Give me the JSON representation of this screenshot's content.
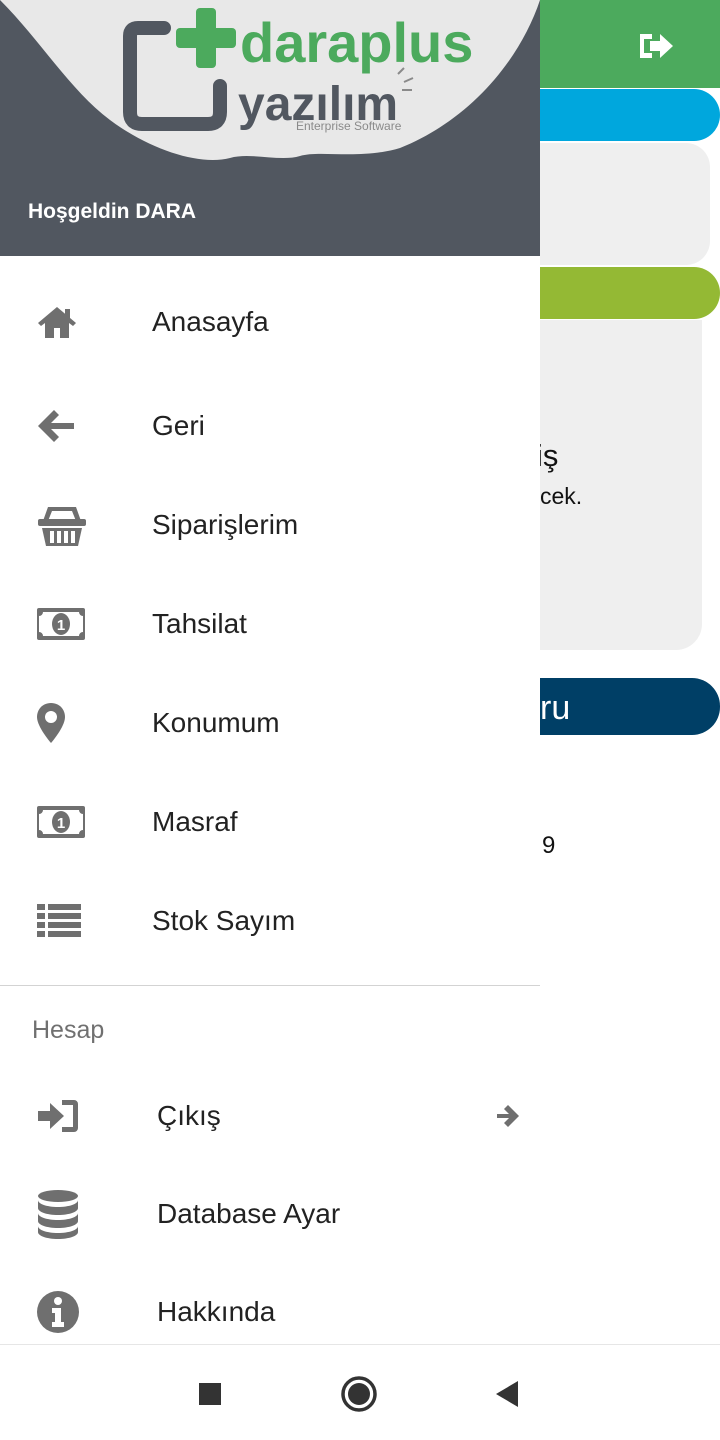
{
  "background": {
    "partial_text_1": "iş",
    "partial_text_2": "cek.",
    "partial_button_label": "ru",
    "partial_text_3": "9",
    "colors": {
      "topbar": "#4caa5d",
      "pill_blue": "#00a7dd",
      "pill_green": "#94b934",
      "pill_navy": "#003f66",
      "card": "#efefef"
    }
  },
  "drawer": {
    "logo": {
      "brand_name": "daraplus",
      "brand_sub": "yazılım",
      "tagline": "Enterprise Software"
    },
    "welcome_text": "Hoşgeldin DARA",
    "menu": [
      {
        "label": "Anasayfa",
        "icon": "home-icon"
      },
      {
        "label": "Geri",
        "icon": "arrow-left-icon"
      },
      {
        "label": "Siparişlerim",
        "icon": "basket-icon"
      },
      {
        "label": "Tahsilat",
        "icon": "money-bill-icon"
      },
      {
        "label": "Konumum",
        "icon": "map-marker-icon"
      },
      {
        "label": "Masraf",
        "icon": "money-bill-icon"
      },
      {
        "label": "Stok Sayım",
        "icon": "list-icon"
      }
    ],
    "account_section": {
      "title": "Hesap",
      "items": [
        {
          "label": "Çıkış",
          "icon": "sign-in-icon",
          "trailing_icon": "arrow-right-icon"
        },
        {
          "label": "Database Ayar",
          "icon": "database-icon"
        },
        {
          "label": "Hakkında",
          "icon": "info-circle-icon"
        }
      ]
    },
    "colors": {
      "header_bg": "#515760",
      "icon_color": "#6f6f6f",
      "brand_green": "#4caa5d",
      "brand_gray": "#515760"
    }
  },
  "navigation_bar": {
    "buttons": [
      "recents-square-icon",
      "home-circle-icon",
      "back-triangle-icon"
    ]
  }
}
